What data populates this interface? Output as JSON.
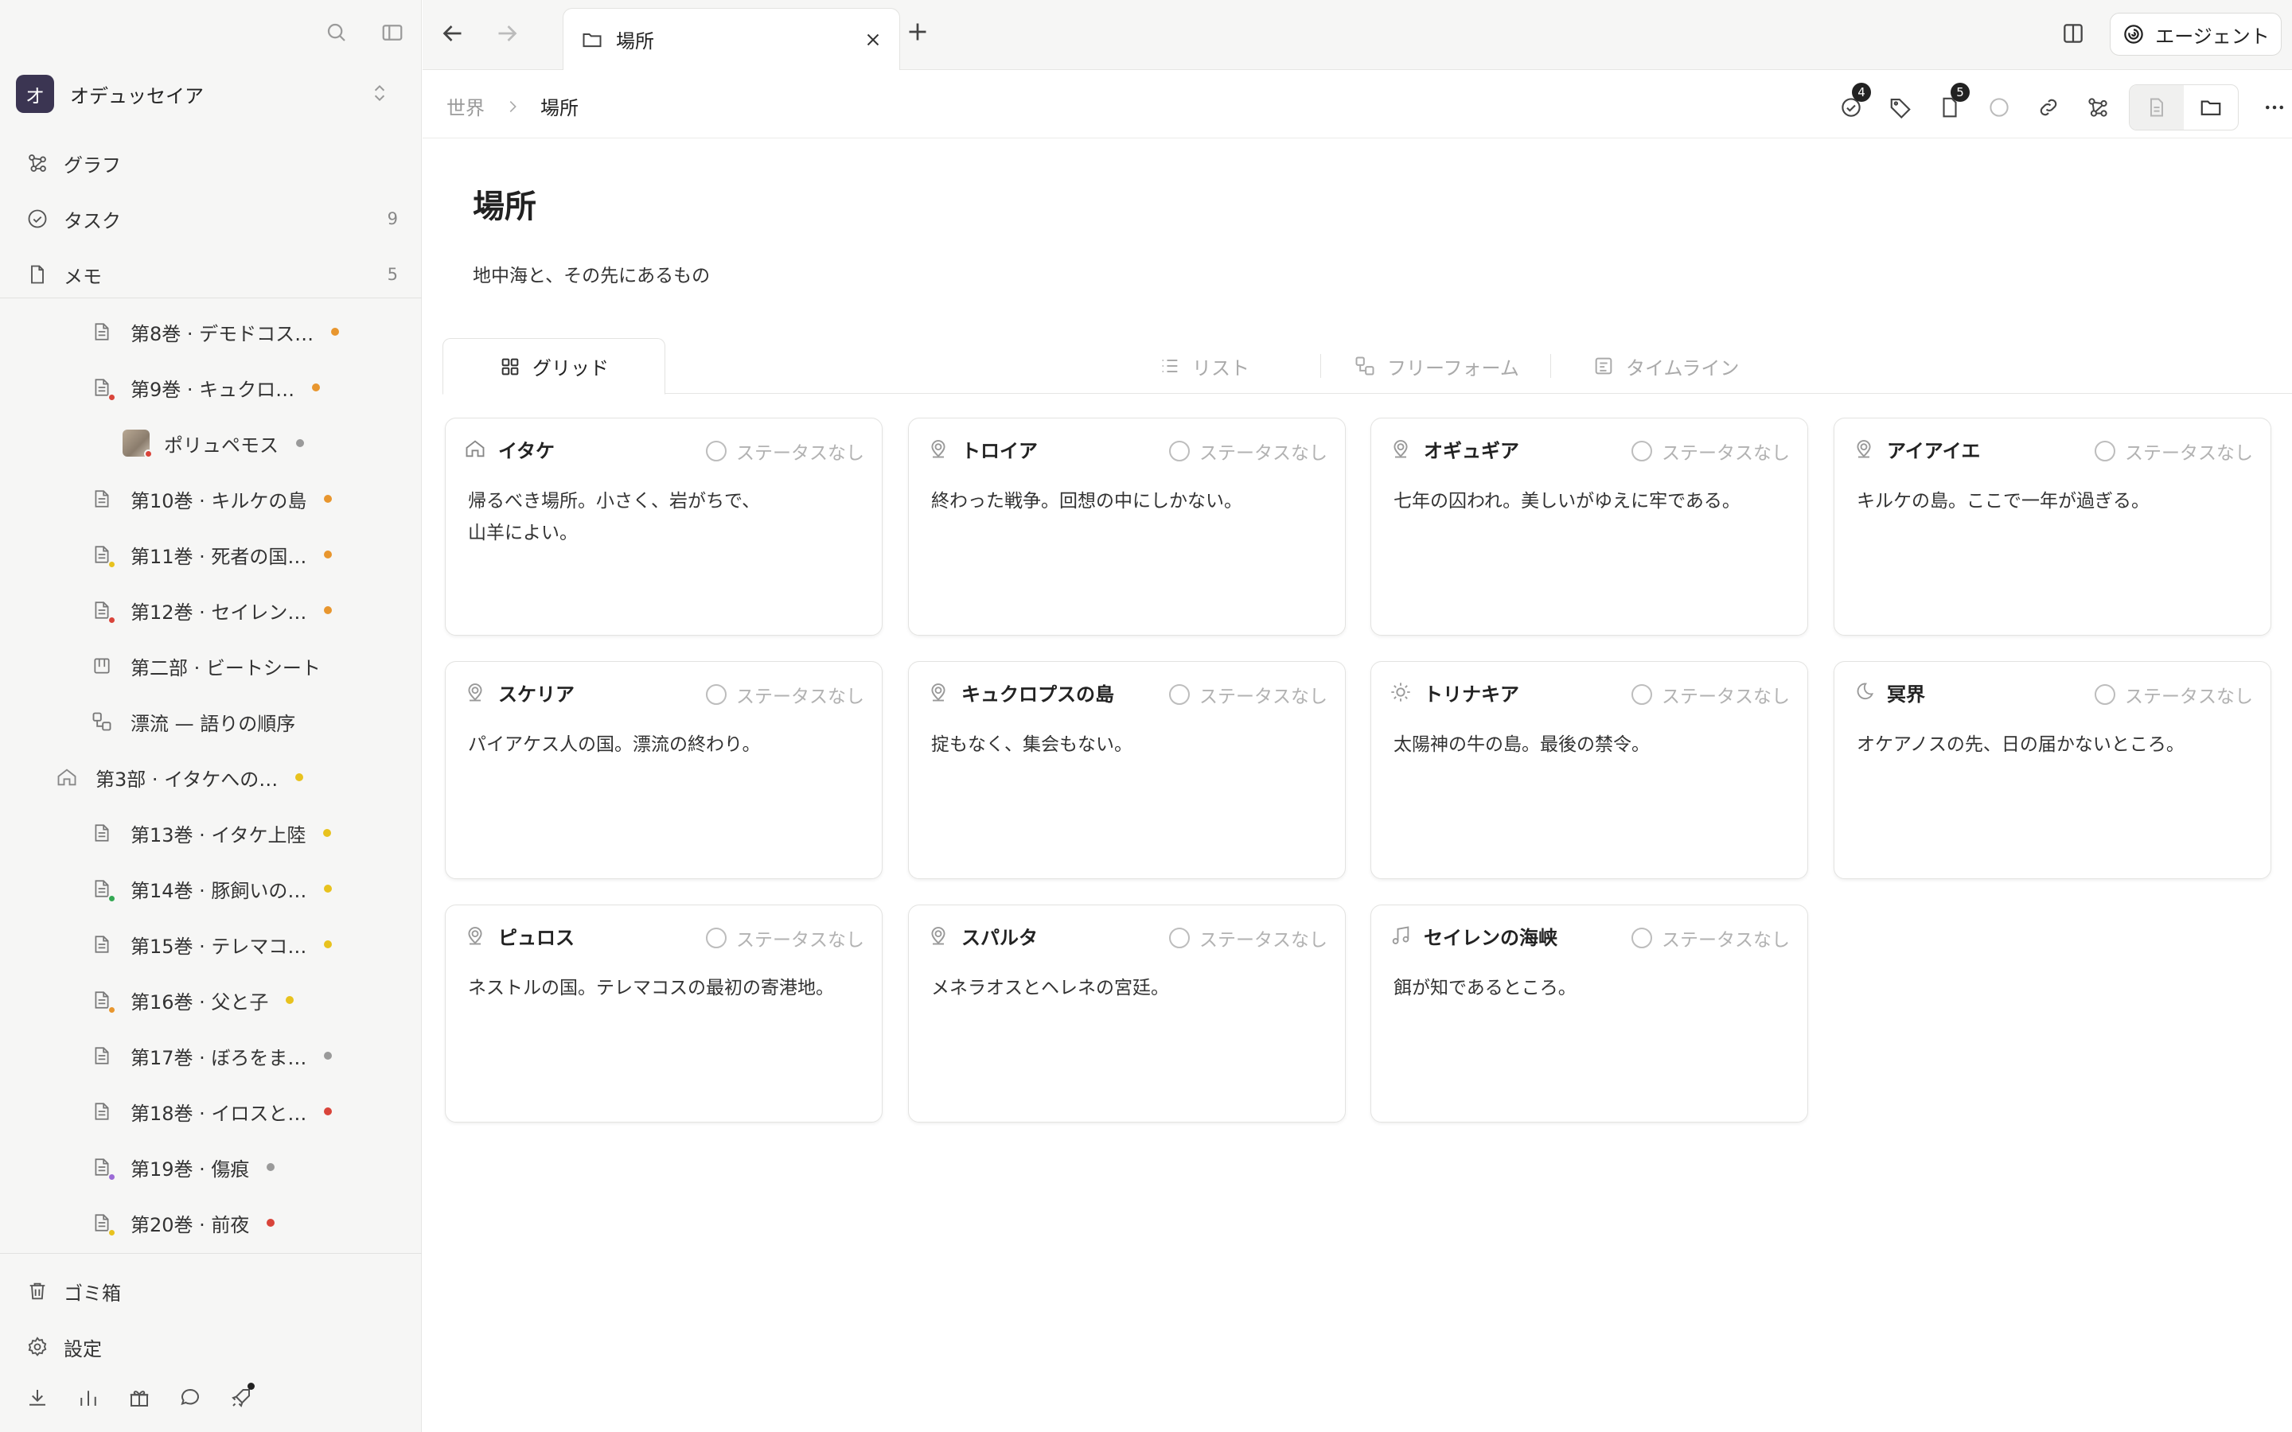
{
  "colors": {
    "sidebar_bg": "#f6f6f5",
    "avatar_bg": "#3b3552",
    "dot_orange": "#e8962e",
    "dot_gray": "#9a9a9a",
    "dot_yellow": "#e8c21e",
    "dot_red": "#d9443a",
    "badge_green": "#34a853",
    "badge_purple": "#9b6ad6"
  },
  "workspace": {
    "initial": "オ",
    "name": "オデュッセイア"
  },
  "sidebar_nav": [
    {
      "icon": "graph-icon",
      "label": "グラフ",
      "count": ""
    },
    {
      "icon": "task-check-icon",
      "label": "タスク",
      "count": "9"
    },
    {
      "icon": "note-icon",
      "label": "メモ",
      "count": "5"
    }
  ],
  "tree": [
    {
      "label": "第8巻 · デモドコス…",
      "dot": "#e8962e",
      "indent": 2,
      "icon": "doc-icon",
      "badge": ""
    },
    {
      "label": "第9巻 · キュクロ…",
      "dot": "#e8962e",
      "indent": 2,
      "icon": "doc-icon",
      "badge": "#d9443a"
    },
    {
      "label": "ポリュペモス",
      "dot": "#9a9a9a",
      "indent": 3,
      "icon": "avatar-image",
      "badge": "#d9443a"
    },
    {
      "label": "第10巻 · キルケの島",
      "dot": "#e8962e",
      "indent": 2,
      "icon": "doc-icon",
      "badge": ""
    },
    {
      "label": "第11巻 · 死者の国…",
      "dot": "#e8962e",
      "indent": 2,
      "icon": "doc-icon",
      "badge": "#e8c21e"
    },
    {
      "label": "第12巻 · セイレン…",
      "dot": "#e8962e",
      "indent": 2,
      "icon": "doc-icon",
      "badge": "#d9443a"
    },
    {
      "label": "第二部 · ビートシート",
      "dot": "",
      "indent": 2,
      "icon": "beat-sheet-icon",
      "badge": ""
    },
    {
      "label": "漂流 — 語りの順序",
      "dot": "",
      "indent": 2,
      "icon": "freeform-icon",
      "badge": ""
    },
    {
      "label": "第3部 · イタケへの…",
      "dot": "#e8c21e",
      "indent": 1,
      "icon": "home-icon",
      "badge": ""
    },
    {
      "label": "第13巻 · イタケ上陸",
      "dot": "#e8c21e",
      "indent": 2,
      "icon": "doc-icon",
      "badge": ""
    },
    {
      "label": "第14巻 · 豚飼いの…",
      "dot": "#e8c21e",
      "indent": 2,
      "icon": "doc-icon",
      "badge": "#34a853"
    },
    {
      "label": "第15巻 · テレマコ…",
      "dot": "#e8c21e",
      "indent": 2,
      "icon": "doc-icon",
      "badge": ""
    },
    {
      "label": "第16巻 · 父と子",
      "dot": "#e8c21e",
      "indent": 2,
      "icon": "doc-icon",
      "badge": "#e8962e"
    },
    {
      "label": "第17巻 · ぼろをま…",
      "dot": "#9a9a9a",
      "indent": 2,
      "icon": "doc-icon",
      "badge": ""
    },
    {
      "label": "第18巻 · イロスと…",
      "dot": "#d9443a",
      "indent": 2,
      "icon": "doc-icon",
      "badge": ""
    },
    {
      "label": "第19巻 · 傷痕",
      "dot": "#9a9a9a",
      "indent": 2,
      "icon": "doc-icon",
      "badge": "#9b6ad6"
    },
    {
      "label": "第20巻 · 前夜",
      "dot": "#d9443a",
      "indent": 2,
      "icon": "doc-icon",
      "badge": "#e8c21e"
    }
  ],
  "sidebar_bottom": [
    {
      "icon": "trash-icon",
      "label": "ゴミ箱"
    },
    {
      "icon": "settings-gear-icon",
      "label": "設定"
    }
  ],
  "tab": {
    "label": "場所"
  },
  "agent_button": {
    "label": "エージェント"
  },
  "breadcrumb": {
    "parent": "世界",
    "current": "場所"
  },
  "toolbar": {
    "tasks_count": "4",
    "notes_count": "5"
  },
  "page": {
    "title": "場所",
    "description": "地中海と、その先にあるもの"
  },
  "views": [
    "グリッド",
    "リスト",
    "フリーフォーム",
    "タイムライン"
  ],
  "status_placeholder": "ステータスなし",
  "cards": [
    {
      "title": "イタケ",
      "icon": "home-icon",
      "body": "帰るべき場所。小さく、岩がちで、\n山羊によい。"
    },
    {
      "title": "トロイア",
      "icon": "location-pin-icon",
      "body": "終わった戦争。回想の中にしかない。"
    },
    {
      "title": "オギュギア",
      "icon": "location-pin-icon",
      "body": "七年の囚われ。美しいがゆえに牢である。"
    },
    {
      "title": "アイアイエ",
      "icon": "location-pin-icon",
      "body": "キルケの島。ここで一年が過ぎる。"
    },
    {
      "title": "スケリア",
      "icon": "location-pin-icon",
      "body": "パイアケス人の国。漂流の終わり。"
    },
    {
      "title": "キュクロプスの島",
      "icon": "location-pin-icon",
      "body": "掟もなく、集会もない。"
    },
    {
      "title": "トリナキア",
      "icon": "sun-icon",
      "body": "太陽神の牛の島。最後の禁令。"
    },
    {
      "title": "冥界",
      "icon": "moon-icon",
      "body": "オケアノスの先、日の届かないところ。"
    },
    {
      "title": "ピュロス",
      "icon": "location-pin-icon",
      "body": "ネストルの国。テレマコスの最初の寄港地。"
    },
    {
      "title": "スパルタ",
      "icon": "location-pin-icon",
      "body": "メネラオスとヘレネの宮廷。"
    },
    {
      "title": "セイレンの海峡",
      "icon": "music-note-icon",
      "body": "餌が知であるところ。"
    }
  ]
}
